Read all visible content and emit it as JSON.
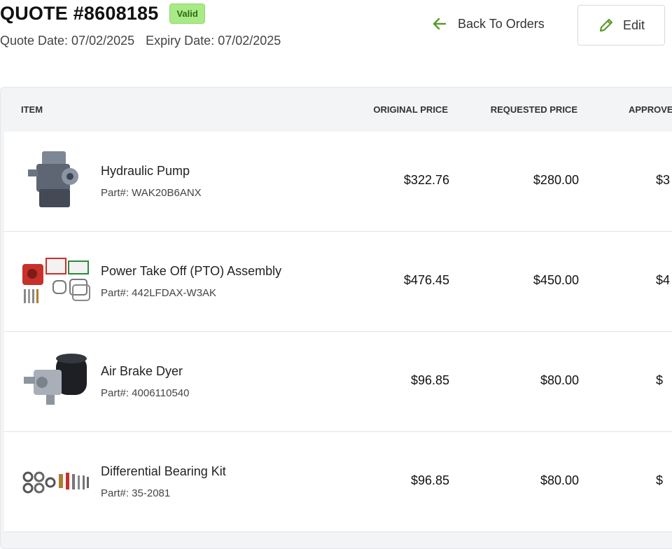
{
  "quote": {
    "title": "QUOTE #8608185",
    "status": "Valid",
    "quote_date": "Quote Date: 07/02/2025",
    "expiry_date": "Expiry Date: 07/02/2025"
  },
  "actions": {
    "back_label": "Back To Orders",
    "edit_label": "Edit"
  },
  "table": {
    "headers": {
      "item": "ITEM",
      "original": "ORIGINAL PRICE",
      "requested": "REQUESTED PRICE",
      "approved": "APPROVE"
    },
    "rows": [
      {
        "name": "Hydraulic Pump",
        "part": "Part#: WAK20B6ANX",
        "original": "$322.76",
        "requested": "$280.00",
        "approved": "$3"
      },
      {
        "name": "Power Take Off (PTO) Assembly",
        "part": "Part#: 442LFDAX-W3AK",
        "original": "$476.45",
        "requested": "$450.00",
        "approved": "$4"
      },
      {
        "name": "Air Brake Dyer",
        "part": "Part#: 4006110540",
        "original": "$96.85",
        "requested": "$80.00",
        "approved": "$"
      },
      {
        "name": "Differential Bearing Kit",
        "part": "Part#: 35-2081",
        "original": "$96.85",
        "requested": "$80.00",
        "approved": "$"
      }
    ]
  },
  "colors": {
    "accent_green": "#5a9a2e",
    "badge_bg": "#a8ea86",
    "badge_text": "#2f6a16"
  },
  "icons": {
    "back": "arrow-left-icon",
    "edit": "pencil-icon"
  }
}
